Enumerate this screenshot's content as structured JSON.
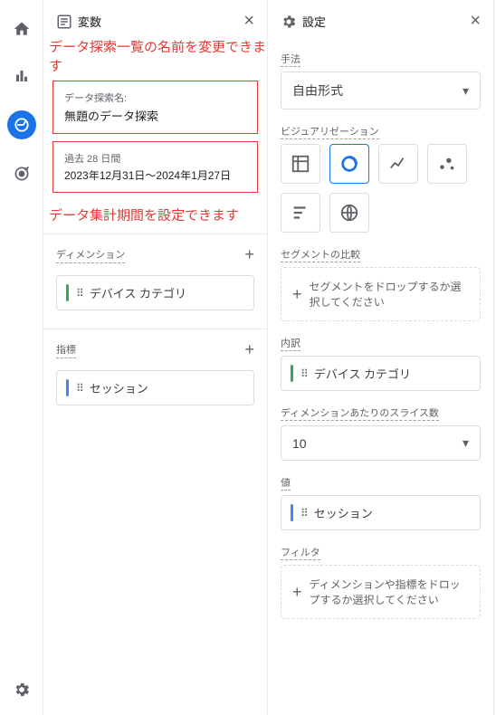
{
  "iconbar": {
    "items": [
      "home",
      "bar-chart",
      "explore",
      "target"
    ],
    "bottom": "settings"
  },
  "vars": {
    "title": "変数",
    "annotation1": "データ探索一覧の名前を変更できます",
    "namebox": {
      "label": "データ探索名:",
      "value": "無題のデータ探索"
    },
    "datebox": {
      "label": "過去 28 日間",
      "range": "2023年12月31日～2024年1月27日"
    },
    "annotation2": "データ集計期間を設定できます",
    "dimension_head": "ディメンション",
    "dimension_chip": "デバイス カテゴリ",
    "metric_head": "指標",
    "metric_chip": "セッション"
  },
  "settings": {
    "title": "設定",
    "technique_label": "手法",
    "technique_value": "自由形式",
    "viz_label": "ビジュアリゼーション",
    "segment_label": "セグメントの比較",
    "segment_drop": "セグメントをドロップするか選択してください",
    "breakdown_label": "内訳",
    "breakdown_chip": "デバイス カテゴリ",
    "slices_label": "ディメンションあたりのスライス数",
    "slices_value": "10",
    "values_label": "値",
    "values_chip": "セッション",
    "filter_label": "フィルタ",
    "filter_drop": "ディメンションや指標をドロップするか選択してください"
  }
}
